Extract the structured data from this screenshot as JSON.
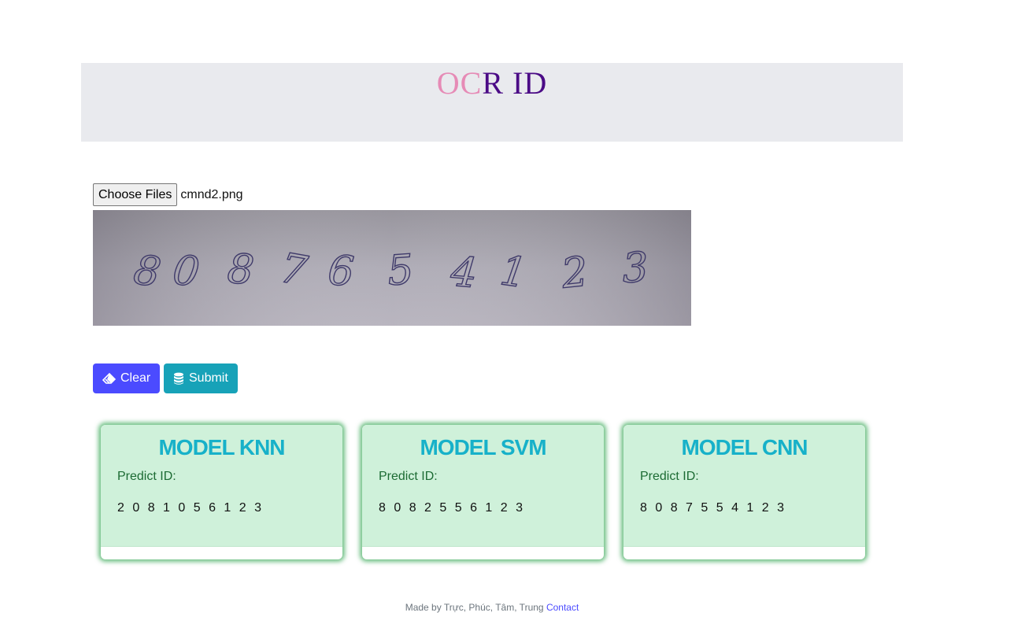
{
  "header": {
    "title_part1": "OC",
    "title_part2": "R ID"
  },
  "upload": {
    "choose_label": "Choose Files",
    "file_name": "cmnd2.png",
    "preview_digits": [
      "8",
      "0",
      "8",
      "7",
      "6",
      "5",
      "4",
      "1",
      "2",
      "3"
    ]
  },
  "actions": {
    "clear_label": "Clear",
    "submit_label": "Submit"
  },
  "results": [
    {
      "title": "MODEL KNN",
      "label": "Predict ID:",
      "value": "2 0 8 1 0 5 6 1 2 3"
    },
    {
      "title": "MODEL SVM",
      "label": "Predict ID:",
      "value": "8 0 8 2 5 5 6 1 2 3"
    },
    {
      "title": "MODEL CNN",
      "label": "Predict ID:",
      "value": "8 0 8 7 5 5 4 1 2 3"
    }
  ],
  "footer": {
    "made_by": "Made by Trực, Phúc, Tâm, Trung",
    "contact": "Contact"
  },
  "colors": {
    "title_pink": "#e68bb6",
    "title_purple": "#4b0b86",
    "clear_button": "#4b4bff",
    "submit_button": "#17a2b8",
    "card_bg": "#cff1da",
    "card_title": "#17b1c9"
  },
  "icons": {
    "clear": "eraser-icon",
    "submit": "database-icon"
  }
}
